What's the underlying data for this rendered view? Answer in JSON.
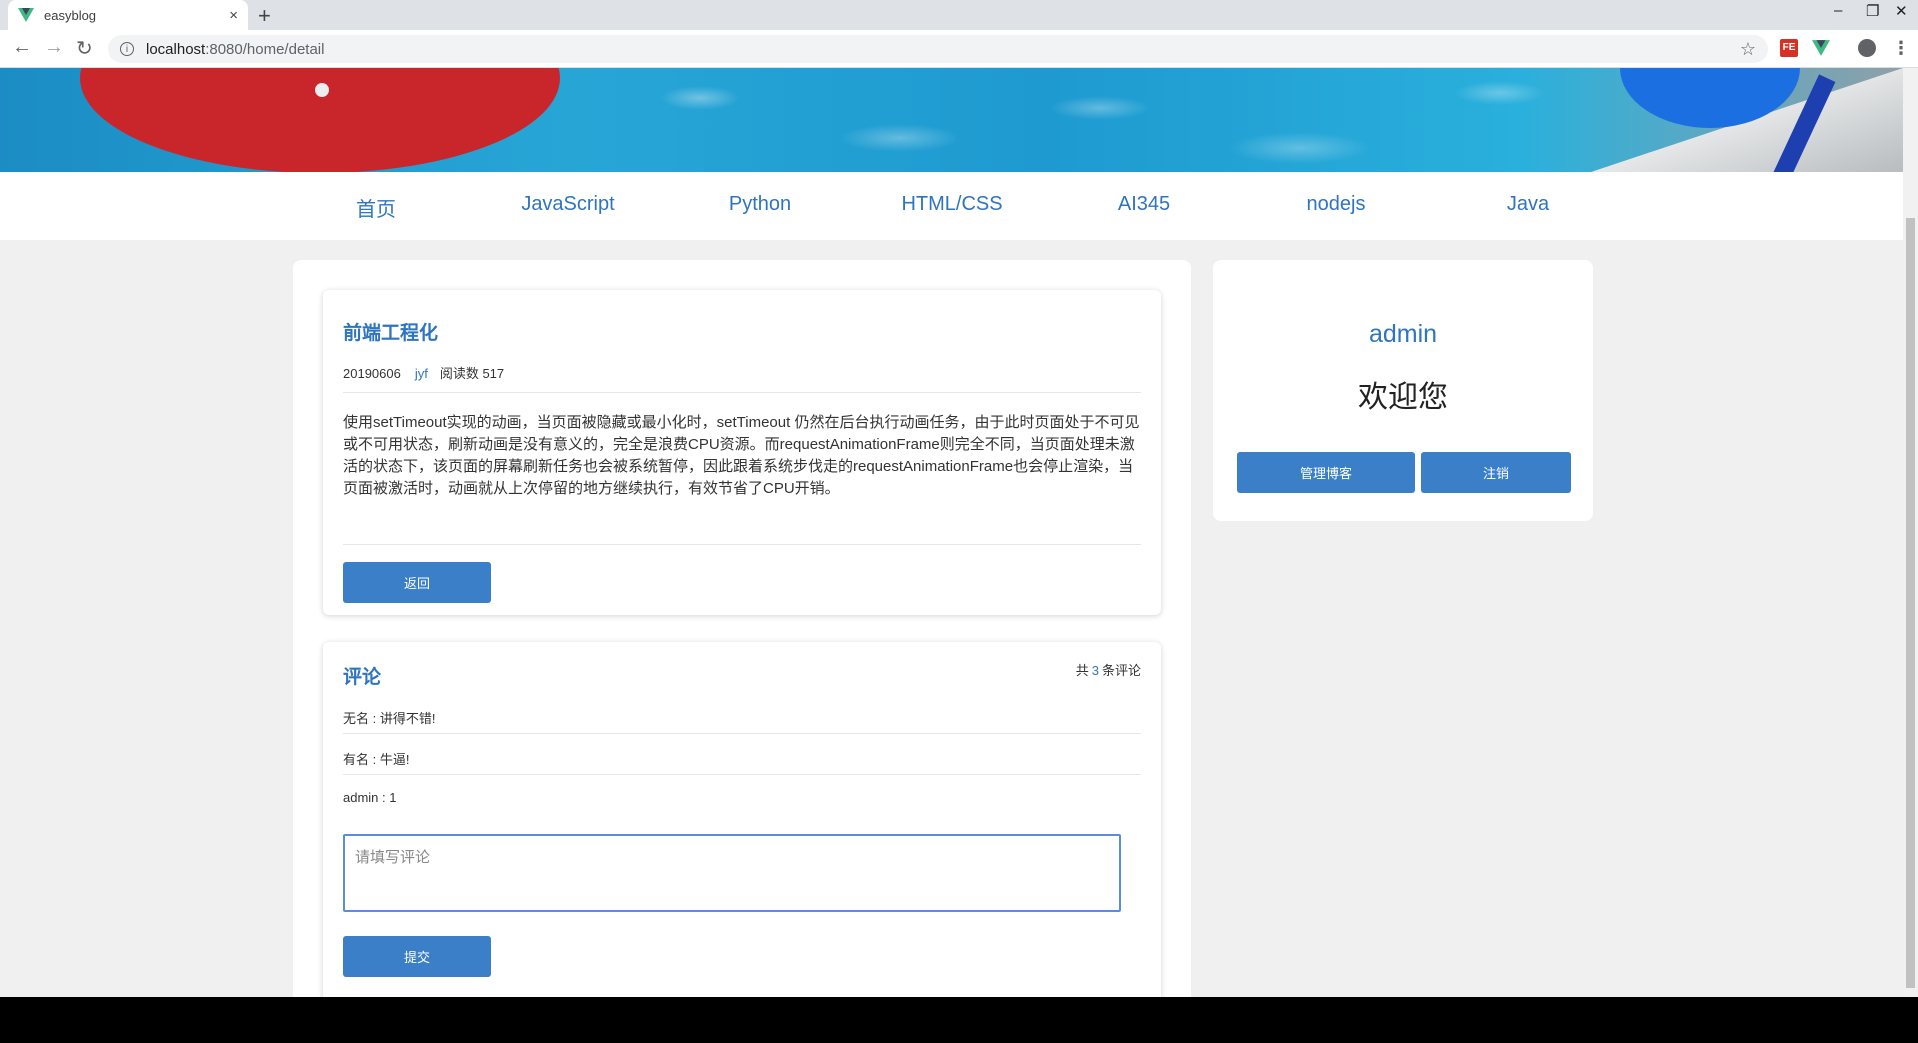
{
  "browser": {
    "tab_title": "easyblog",
    "tab_close": "×",
    "new_tab": "+",
    "url_host": "localhost",
    "url_path": ":8080/home/detail",
    "win_minimize": "–",
    "win_restore": "❐",
    "win_close": "✕"
  },
  "nav": {
    "items": [
      "首页",
      "JavaScript",
      "Python",
      "HTML/CSS",
      "AI345",
      "nodejs",
      "Java"
    ]
  },
  "article": {
    "title": "前端工程化",
    "date": "20190606",
    "author": "jyf",
    "reads": "阅读数 517",
    "content": "使用setTimeout实现的动画，当页面被隐藏或最小化时，setTimeout 仍然在后台执行动画任务，由于此时页面处于不可见或不可用状态，刷新动画是没有意义的，完全是浪费CPU资源。而requestAnimationFrame则完全不同，当页面处理未激活的状态下，该页面的屏幕刷新任务也会被系统暂停，因此跟着系统步伐走的requestAnimationFrame也会停止渲染，当页面被激活时，动画就从上次停留的地方继续执行，有效节省了CPU开销。",
    "back_label": "返回"
  },
  "comments": {
    "title": "评论",
    "count_prefix": "共",
    "count": "3",
    "count_suffix": "条评论",
    "items": [
      {
        "text": "无名 : 讲得不错!"
      },
      {
        "text": "有名 : 牛逼!"
      },
      {
        "text": "admin : 1"
      }
    ],
    "placeholder": "请填写评论",
    "submit_label": "提交"
  },
  "sidebar": {
    "username": "admin",
    "welcome": "欢迎您",
    "manage_label": "管理博客",
    "logout_label": "注销"
  }
}
